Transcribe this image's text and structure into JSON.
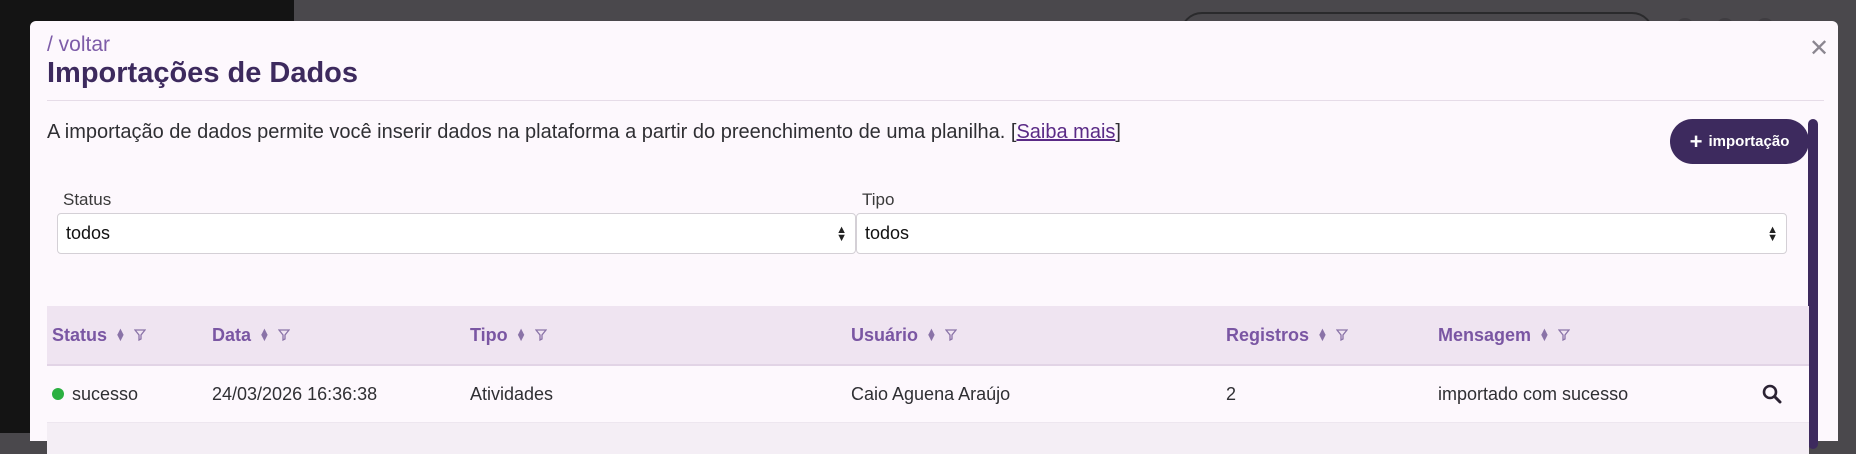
{
  "modal": {
    "back_label": "/ voltar",
    "title": "Importações de Dados",
    "close_icon": "close-icon"
  },
  "description": {
    "text": "A importação de dados permite você inserir dados na plataforma a partir do preenchimento de uma planilha. [",
    "link": "Saiba mais",
    "suffix": "]"
  },
  "add_button": {
    "icon": "plus-icon",
    "label": "importação"
  },
  "filters": {
    "status": {
      "label": "Status",
      "value": "todos"
    },
    "tipo": {
      "label": "Tipo",
      "value": "todos"
    }
  },
  "table": {
    "columns": [
      "Status",
      "Data",
      "Tipo",
      "Usuário",
      "Registros",
      "Mensagem"
    ],
    "rows": [
      {
        "status": "sucesso",
        "data": "24/03/2026 16:36:38",
        "tipo": "Atividades",
        "usuario": "Caio Aguena Araújo",
        "registros": "2",
        "mensagem": "importado com sucesso",
        "action_icon": "search-icon"
      }
    ]
  },
  "colors": {
    "primary": "#3d2a5e",
    "accent": "#7a56a3",
    "success": "#2bb041",
    "header_bg": "#efe4f1"
  }
}
